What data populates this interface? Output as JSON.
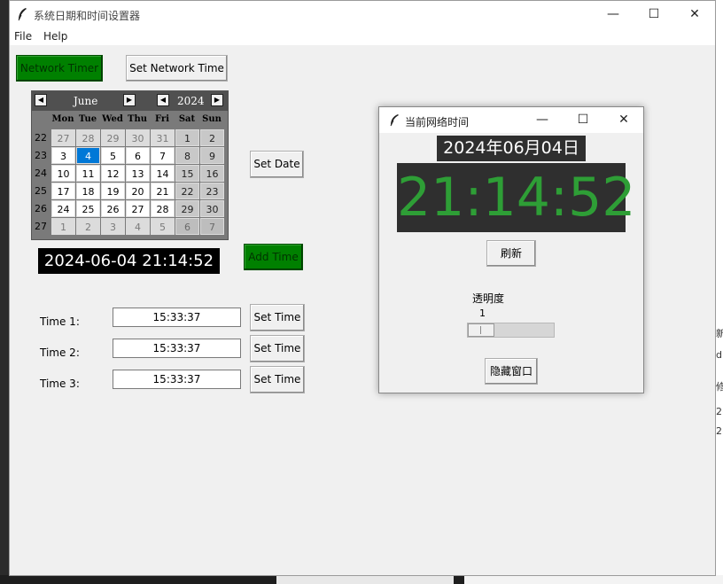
{
  "background_peek": [
    "新",
    "d",
    "修",
    "2(",
    "2("
  ],
  "main_window": {
    "title": "系统日期和时间设置器",
    "controls": {
      "minimize": "—",
      "maximize": "☐",
      "close": "✕"
    },
    "menu": [
      "File",
      "Help"
    ],
    "network_timer_label": "Network Timer",
    "set_network_time_label": "Set Network Time",
    "calendar": {
      "month": "June",
      "year": "2024",
      "weekday_headers": [
        "Mon",
        "Tue",
        "Wed",
        "Thu",
        "Fri",
        "Sat",
        "Sun"
      ],
      "week_numbers": [
        "22",
        "23",
        "24",
        "25",
        "26",
        "27"
      ],
      "days": [
        [
          "27",
          "28",
          "29",
          "30",
          "31",
          "1",
          "2"
        ],
        [
          "3",
          "4",
          "5",
          "6",
          "7",
          "8",
          "9"
        ],
        [
          "10",
          "11",
          "12",
          "13",
          "14",
          "15",
          "16"
        ],
        [
          "17",
          "18",
          "19",
          "20",
          "21",
          "22",
          "23"
        ],
        [
          "24",
          "25",
          "26",
          "27",
          "28",
          "29",
          "30"
        ],
        [
          "1",
          "2",
          "3",
          "4",
          "5",
          "6",
          "7"
        ]
      ],
      "selected_day": "4"
    },
    "set_date_label": "Set Date",
    "datetime_display": "2024-06-04 21:14:52",
    "add_time_label": "Add Time",
    "times": [
      {
        "label": "Time 1:",
        "value": "15:33:37",
        "button": "Set Time"
      },
      {
        "label": "Time 2:",
        "value": "15:33:37",
        "button": "Set Time"
      },
      {
        "label": "Time 3:",
        "value": "15:33:37",
        "button": "Set Time"
      }
    ]
  },
  "network_window": {
    "title": "当前网络时间",
    "controls": {
      "minimize": "—",
      "maximize": "☐",
      "close": "✕"
    },
    "date": "2024年06月04日",
    "time": "21:14:52",
    "time_color": "#2e9e36",
    "refresh_label": "刷新",
    "opacity_label": "透明度",
    "opacity_value": "1",
    "hide_window_label": "隐藏窗口"
  }
}
